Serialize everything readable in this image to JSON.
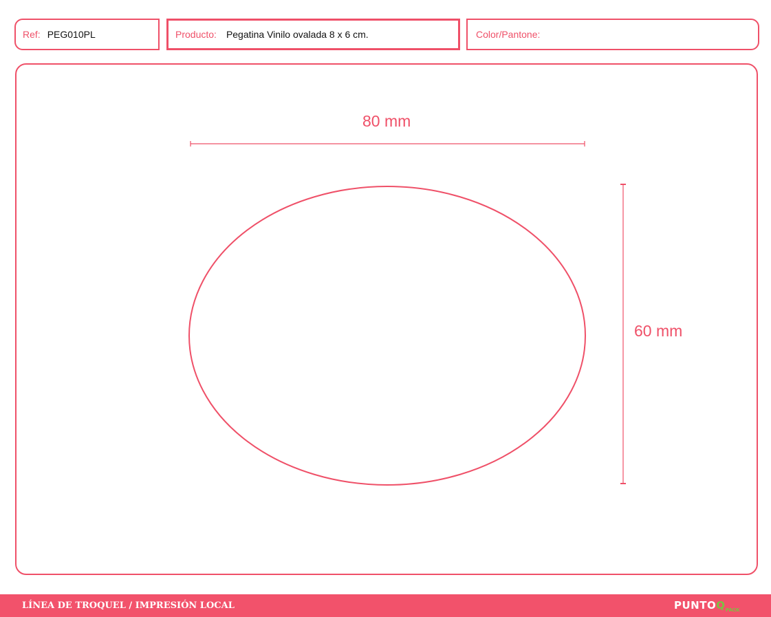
{
  "header": {
    "ref": {
      "label": "Ref:",
      "value": "PEG010PL"
    },
    "product": {
      "label": "Producto:",
      "value": "Pegatina Vinilo ovalada 8 x 6 cm."
    },
    "color": {
      "label": "Color/Pantone:",
      "value": ""
    }
  },
  "drawing": {
    "width_label": "80 mm",
    "height_label": "60 mm"
  },
  "footer": {
    "title": "LÍNEA DE TROQUEL / IMPRESIÓN LOCAL",
    "brand_main": "PUNTO",
    "brand_q": "Q",
    "brand_sub": "PACK"
  },
  "colors": {
    "accent": "#ef5068",
    "footer_bg": "#f2526b",
    "brand_green": "#7cc242",
    "text": "#111111"
  }
}
